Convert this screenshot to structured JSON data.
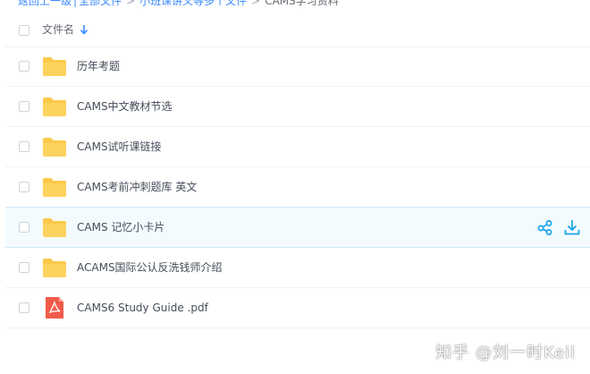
{
  "breadcrumb": {
    "back": "返回上一级",
    "all_files": "全部文件",
    "folder_1": "小班课讲义等多个文件",
    "current": "CAMS学习资料"
  },
  "header": {
    "column_name": "文件名"
  },
  "files": [
    {
      "name": "历年考题",
      "type": "folder"
    },
    {
      "name": "CAMS中文教材节选",
      "type": "folder"
    },
    {
      "name": "CAMS试听课链接",
      "type": "folder"
    },
    {
      "name": "CAMS考前冲刺题库 英文",
      "type": "folder"
    },
    {
      "name": "CAMS 记忆小卡片",
      "type": "folder",
      "hovered": true
    },
    {
      "name": "ACAMS国际公认反洗钱师介绍",
      "type": "folder"
    },
    {
      "name": "CAMS6 Study Guide .pdf",
      "type": "pdf"
    }
  ],
  "watermark": "知乎 @刘一时Keil",
  "colors": {
    "accent": "#3b8cff",
    "folder": "#fcc94b",
    "pdf": "#f15a4a",
    "action": "#1aa3e8"
  }
}
